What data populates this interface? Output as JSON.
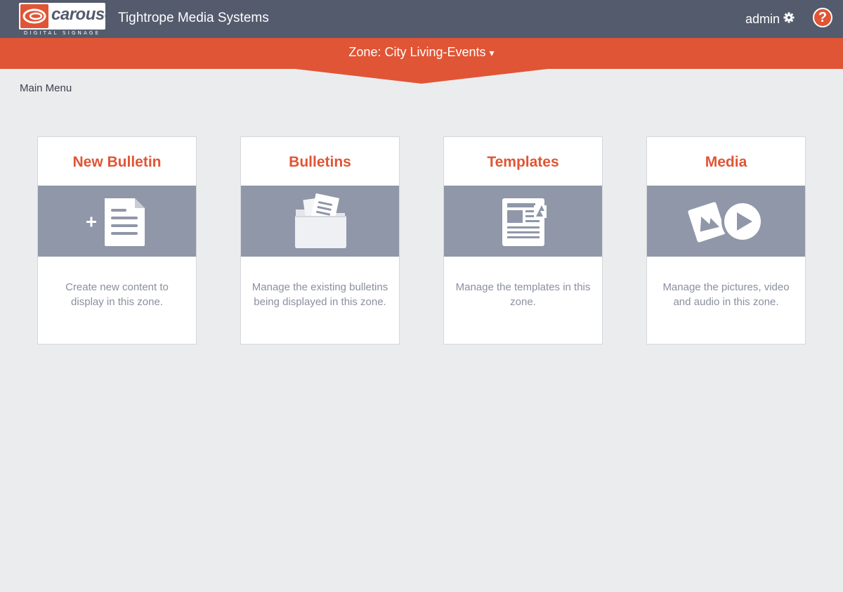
{
  "header": {
    "logo_word": "carousel",
    "logo_subtitle": "DIGITAL SIGNAGE",
    "company_name": "Tightrope Media Systems",
    "username": "admin",
    "help_label": "?",
    "icons": {
      "settings": "gear-icon",
      "help": "question-circle-icon"
    }
  },
  "zone": {
    "label": "Zone: City Living-Events",
    "caret": "▾"
  },
  "breadcrumb": "Main Menu",
  "cards": [
    {
      "title": "New Bulletin",
      "icon": "new-document-icon",
      "description": "Create new content to display in this zone."
    },
    {
      "title": "Bulletins",
      "icon": "folder-documents-icon",
      "description": "Manage the existing bulletins being displayed in this zone."
    },
    {
      "title": "Templates",
      "icon": "template-icon",
      "description": "Manage the templates in this zone."
    },
    {
      "title": "Media",
      "icon": "media-icon",
      "description": "Manage the pictures, video and audio in this zone."
    }
  ],
  "colors": {
    "header_bg": "#535b6d",
    "accent": "#e05535",
    "band": "#8f97a8",
    "page_bg": "#ebecee"
  }
}
